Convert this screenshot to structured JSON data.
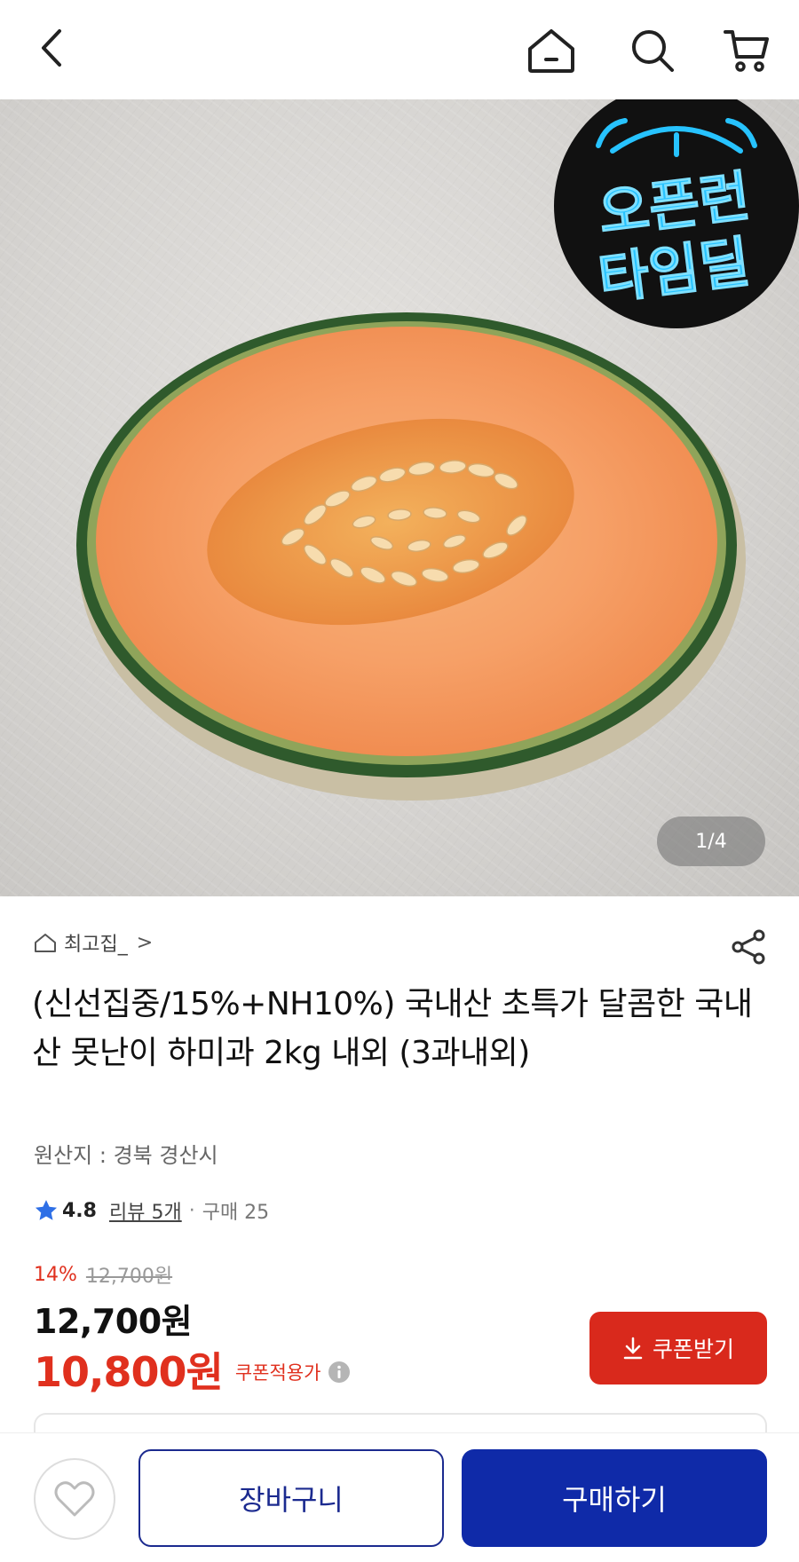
{
  "header": {
    "icons": [
      "back-arrow-icon",
      "home-icon",
      "search-icon",
      "cart-icon"
    ]
  },
  "hero": {
    "badge_line1": "오픈런",
    "badge_line2": "타임딜",
    "image_counter": "1/4",
    "badge_colors": {
      "bg": "#111111",
      "neon": "#27c3ff"
    }
  },
  "product": {
    "store_name": "최고집_",
    "store_chevron": ">",
    "title": "(신선집중/15%+NH10%) 국내산 초특가 달콤한 국내산 못난이 하미과 2kg 내외 (3과내외)",
    "origin": "원산지 : 경북 경산시",
    "rating": "4.8",
    "review_label": "리뷰 5개",
    "separator": "·",
    "purchase_label": "구매 25"
  },
  "price": {
    "discount_rate": "14%",
    "original_price": "12,700원",
    "price": "12,700원",
    "coupon_price": "10,800원",
    "coupon_applied_label": "쿠폰적용가",
    "coupon_button_label": "쿠폰받기"
  },
  "bottom_bar": {
    "cart_label": "장바구니",
    "buy_label": "구매하기"
  },
  "colors": {
    "accent_red": "#e0301e",
    "button_red": "#d9291c",
    "primary_blue": "#0f2aa8",
    "outline_blue": "#1b2a8f",
    "star_blue": "#2e6fe6"
  }
}
